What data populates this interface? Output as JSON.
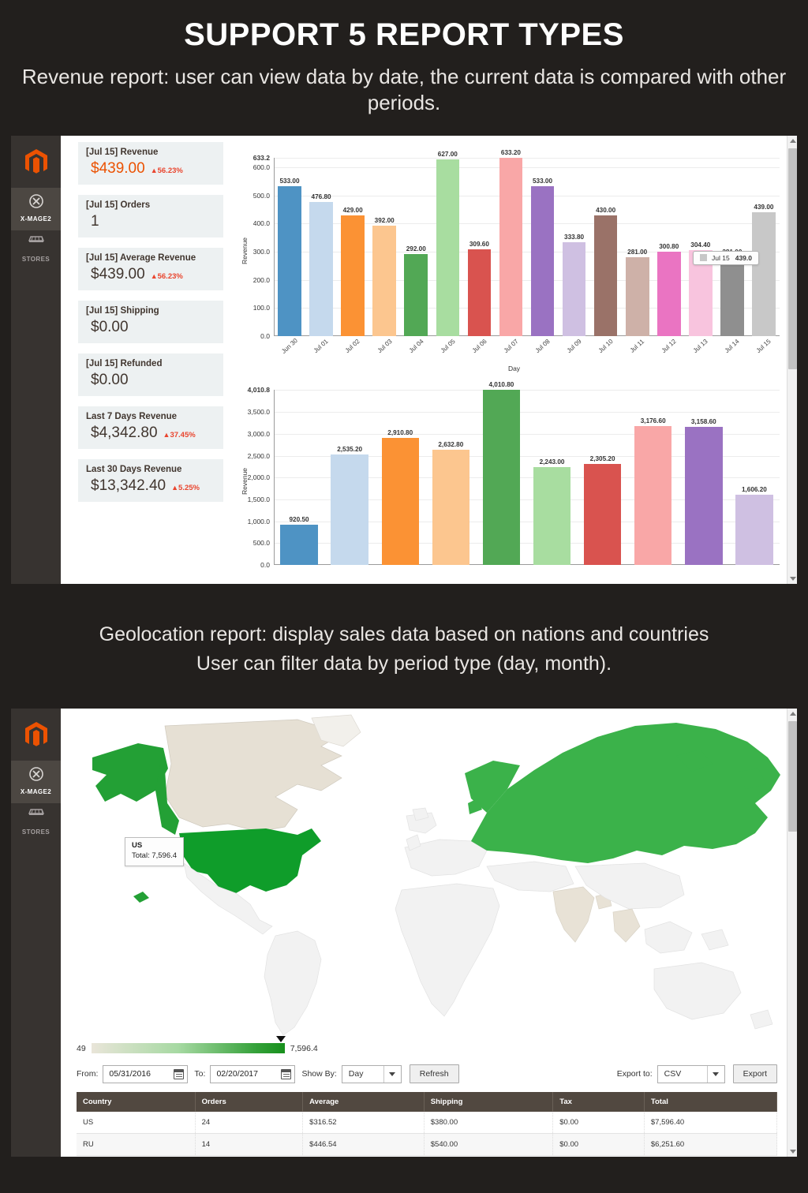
{
  "headings": {
    "main_title": "SUPPORT 5 REPORT TYPES",
    "revenue_caption": "Revenue report: user can view data by date, the current data is compared with other periods.",
    "geo_caption_line1": "Geolocation report: display sales data based on nations and countries",
    "geo_caption_line2": "User can filter data by period type (day, month)."
  },
  "sidebar": {
    "items": [
      {
        "icon": "magento-logo-icon",
        "label": ""
      },
      {
        "icon": "x-mage2-icon",
        "label": "X-MAGE2",
        "active": true
      },
      {
        "icon": "stores-icon",
        "label": "STORES",
        "active": false
      }
    ]
  },
  "kpi_cards": [
    {
      "title": "[Jul 15] Revenue",
      "value": "$439.00",
      "delta": "56.23%",
      "accent": true
    },
    {
      "title": "[Jul 15] Orders",
      "value": "1",
      "delta": "",
      "accent": false
    },
    {
      "title": "[Jul 15] Average Revenue",
      "value": "$439.00",
      "delta": "56.23%",
      "accent": false
    },
    {
      "title": "[Jul 15] Shipping",
      "value": "$0.00",
      "delta": "",
      "accent": false
    },
    {
      "title": "[Jul 15] Refunded",
      "value": "$0.00",
      "delta": "",
      "accent": false
    },
    {
      "title": "Last 7 Days Revenue",
      "value": "$4,342.80",
      "delta": "37.45%",
      "accent": false
    },
    {
      "title": "Last 30 Days Revenue",
      "value": "$13,342.40",
      "delta": "5.25%",
      "accent": false
    }
  ],
  "chart_data": [
    {
      "type": "bar",
      "id": "daily-revenue",
      "title": "",
      "xlabel": "Day",
      "ylabel": "Revenue",
      "ylim": [
        0,
        633.2
      ],
      "grid": true,
      "yticks": [
        "0.0",
        "100.0",
        "200.0",
        "300.0",
        "400.0",
        "500.0",
        "600.0",
        "633.2"
      ],
      "ytick_values": [
        0,
        100,
        200,
        300,
        400,
        500,
        600,
        633.2
      ],
      "categories": [
        "Jun 30",
        "Jul 01",
        "Jul 02",
        "Jul 03",
        "Jul 04",
        "Jul 05",
        "Jul 06",
        "Jul 07",
        "Jul 08",
        "Jul 09",
        "Jul 10",
        "Jul 11",
        "Jul 12",
        "Jul 13",
        "Jul 14",
        "Jul 15"
      ],
      "values": [
        533.0,
        476.8,
        429.0,
        392.0,
        292.0,
        627.0,
        309.6,
        633.2,
        533.0,
        333.8,
        430.0,
        281.0,
        300.8,
        304.4,
        281.0,
        439.0
      ],
      "labels": [
        "533.00",
        "476.80",
        "429.00",
        "392.00",
        "292.00",
        "627.00",
        "309.60",
        "633.20",
        "533.00",
        "333.80",
        "430.00",
        "281.00",
        "300.80",
        "304.40",
        "281.00",
        "439.00"
      ],
      "colors": [
        "#4e93c4",
        "#c5d9ed",
        "#fb9234",
        "#fcc68f",
        "#54a css",
        "#000000",
        "#000000",
        "#000000",
        "#000000",
        "#000000",
        "#000000",
        "#000000",
        "#000000",
        "#000000",
        "#000000",
        "#000000"
      ],
      "bar_colors": [
        "#4e93c4",
        "#c5d9ed",
        "#fb9234",
        "#fcc68f",
        "#52a855",
        "#a8ddA0",
        "#d9534f",
        "#f9a7a7",
        "#9a72c2",
        "#cfc0e2",
        "#9a7268",
        "#ceb1a8",
        "#ea74c2",
        "#f8c4de",
        "#8f8f8f",
        "#c8c8c8"
      ],
      "tooltip": {
        "series": "Jul 15",
        "value": "439.0"
      }
    },
    {
      "type": "bar",
      "id": "period-revenue",
      "title": "",
      "xlabel": "",
      "ylabel": "Revenue",
      "ylim": [
        0,
        4010.8
      ],
      "grid": true,
      "yticks": [
        "0.0",
        "500.0",
        "1,000.0",
        "1,500.0",
        "2,000.0",
        "2,500.0",
        "3,000.0",
        "3,500.0",
        "4,010.8"
      ],
      "ytick_values": [
        0,
        500,
        1000,
        1500,
        2000,
        2500,
        3000,
        3500,
        4010.8
      ],
      "categories": [
        "",
        "",
        "",
        "",
        "",
        "",
        "",
        "",
        "",
        ""
      ],
      "values": [
        920.5,
        2535.2,
        2910.8,
        2632.8,
        4010.8,
        2243.0,
        2305.2,
        3176.6,
        3158.6,
        1606.2
      ],
      "labels": [
        "920.50",
        "2,535.20",
        "2,910.80",
        "2,632.80",
        "4,010.80",
        "2,243.00",
        "2,305.20",
        "3,176.60",
        "3,158.60",
        "1,606.20"
      ],
      "bar_colors": [
        "#4e93c4",
        "#c5d9ed",
        "#fb9234",
        "#fcc68f",
        "#52a855",
        "#a8dda0",
        "#d9534f",
        "#f9a7a7",
        "#9a72c2",
        "#cfc0e2"
      ]
    }
  ],
  "geo": {
    "map_tooltip": {
      "country": "US",
      "total_label": "Total: 7,596.4"
    },
    "legend": {
      "min": "49",
      "max": "7,596.4"
    },
    "toolbar": {
      "from_label": "From:",
      "from_value": "05/31/2016",
      "to_label": "To:",
      "to_value": "02/20/2017",
      "show_by_label": "Show By:",
      "show_by_value": "Day",
      "refresh_label": "Refresh",
      "export_to_label": "Export to:",
      "export_format": "CSV",
      "export_label": "Export"
    },
    "table": {
      "columns": [
        "Country",
        "Orders",
        "Average",
        "Shipping",
        "Tax",
        "Total"
      ],
      "rows": [
        [
          "US",
          "24",
          "$316.52",
          "$380.00",
          "$0.00",
          "$7,596.40"
        ],
        [
          "RU",
          "14",
          "$446.54",
          "$540.00",
          "$0.00",
          "$6,251.60"
        ]
      ]
    },
    "colors": {
      "highlight": "#2ca02c",
      "map_base": "#f0f0f0",
      "map_beige": "#e6e0d4"
    }
  }
}
